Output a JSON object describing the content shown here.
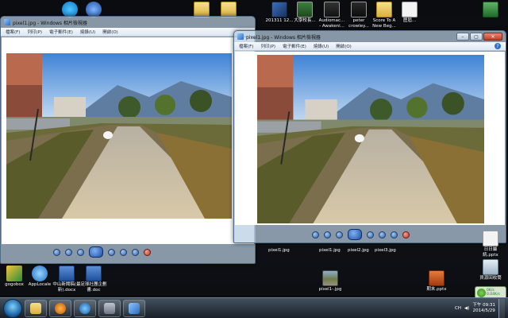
{
  "desktop": {
    "top_icons": [
      {
        "label": "",
        "icon": "skype-icon"
      },
      {
        "label": "",
        "icon": "refresh-app-icon"
      },
      {
        "label": "",
        "icon": "folder-icon"
      },
      {
        "label": "",
        "icon": "folder-icon"
      },
      {
        "label": "201311 12...",
        "icon": "dvd-icon"
      },
      {
        "label": "大學校長...",
        "icon": "document-icon"
      },
      {
        "label": "Audiomac... - Awakeni...",
        "icon": "document-icon"
      },
      {
        "label": "peter crowley...",
        "icon": "document-icon"
      },
      {
        "label": "Score To A New Beg...",
        "icon": "folder-icon"
      },
      {
        "label": "歷屆...",
        "icon": "document-icon"
      },
      {
        "label": "",
        "icon": "excel-icon"
      }
    ],
    "bottom_icons": [
      {
        "label": "gogobox",
        "icon": "app-icon"
      },
      {
        "label": "AppLocale",
        "icon": "app-icon"
      },
      {
        "label": "中山新聞稿(最新).docx",
        "icon": "word-icon"
      },
      {
        "label": "足球社團企劃書.doc",
        "icon": "word-icon"
      },
      {
        "label": "pixel1-.jpg",
        "icon": "image-icon"
      },
      {
        "label": "期末.pptx",
        "icon": "ppt-icon"
      },
      {
        "label": "資源回收筒",
        "icon": "recycle-bin-icon"
      }
    ],
    "right_icons": [
      {
        "label": "日日屬統.pptx",
        "icon": "ppt-icon"
      }
    ],
    "strip_labels": [
      "pixel1.jpg",
      "pixel1.jpg",
      "pixel2.jpg",
      "pixel3.jpg"
    ]
  },
  "window_left": {
    "title": "pixel1.jpg - Windows 相片檢視器",
    "menu": [
      "檔案(F)",
      "列印(P)",
      "電子郵件(E)",
      "燒錄(U)",
      "開啟(O)"
    ]
  },
  "window_right": {
    "title": "pixel1.jpg - Windows 相片檢視器",
    "menu": [
      "檔案(F)",
      "列印(P)",
      "電子郵件(E)",
      "燒錄(U)",
      "開啟(O)"
    ]
  },
  "taskbar": {
    "time": "下午 09:31",
    "date": "2014/5/29",
    "lang": "CH",
    "net_badge_line1": "0K/s",
    "net_badge_line2": "0.04K/s"
  }
}
